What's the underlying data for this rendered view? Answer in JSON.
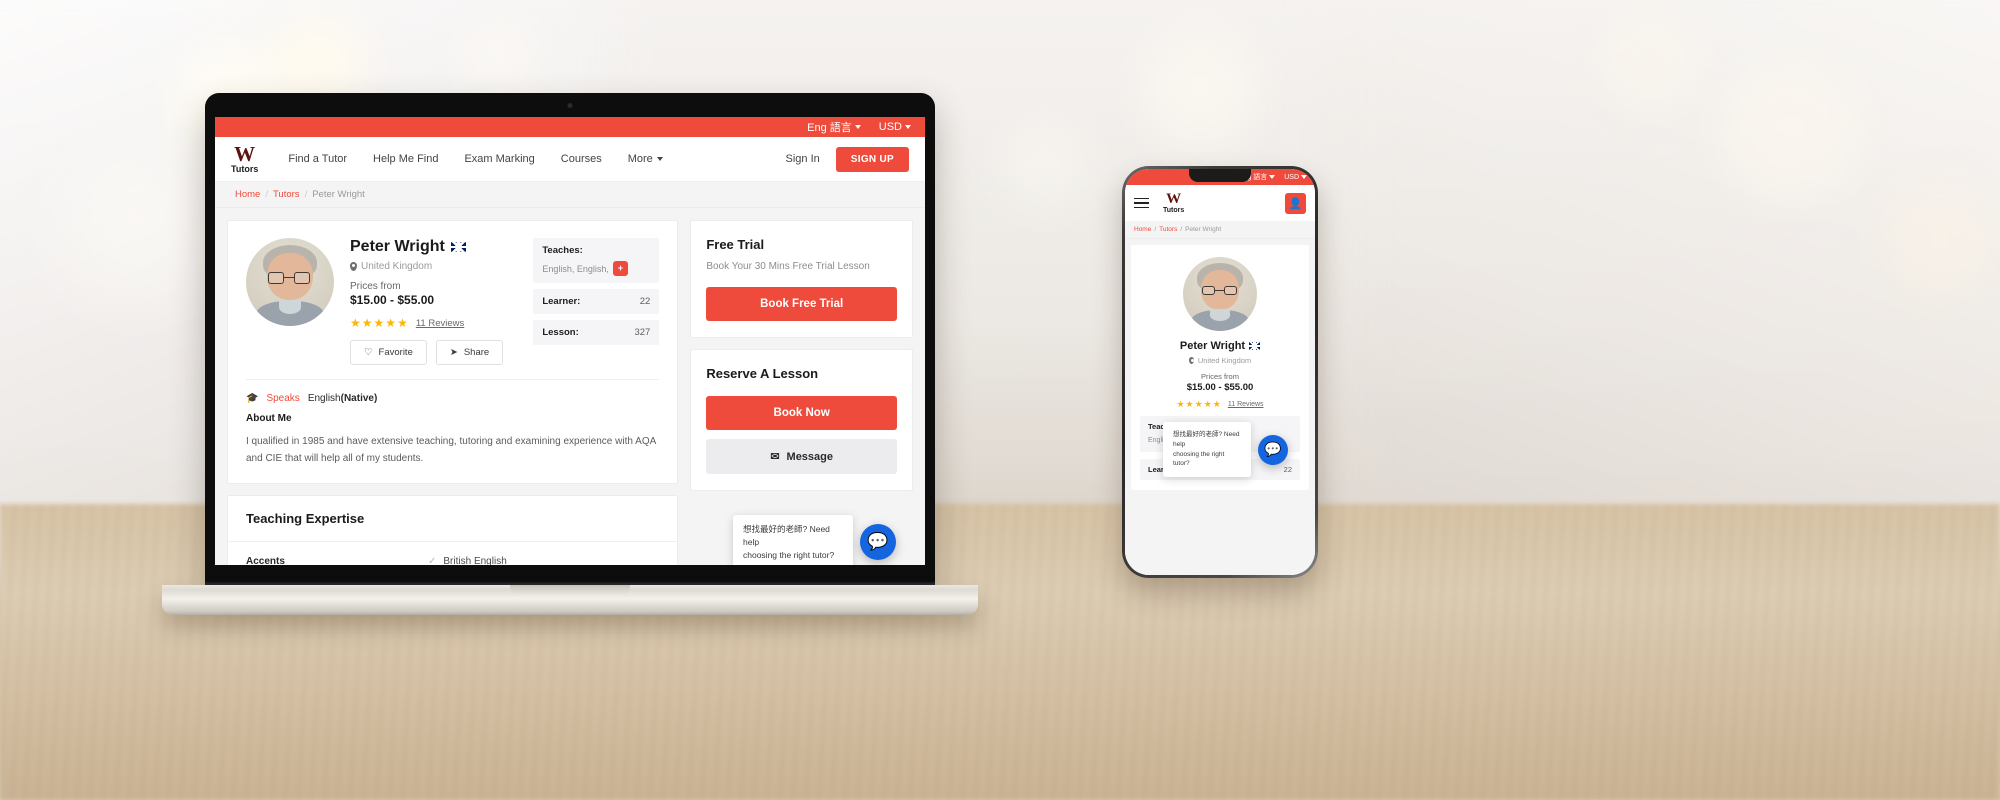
{
  "topbar": {
    "language": "Eng 語言",
    "currency": "USD"
  },
  "brand": {
    "w": "W",
    "tutors": "Tutors",
    "accent": "#ee4b3c",
    "logo_dark": "#5c1410"
  },
  "nav": {
    "links": [
      {
        "label": "Find a Tutor",
        "caret": false
      },
      {
        "label": "Help Me Find",
        "caret": false
      },
      {
        "label": "Exam Marking",
        "caret": false
      },
      {
        "label": "Courses",
        "caret": false
      },
      {
        "label": "More",
        "caret": true
      }
    ],
    "sign_in": "Sign In",
    "sign_up": "SIGN UP"
  },
  "breadcrumb": {
    "home": "Home",
    "tutors": "Tutors",
    "current": "Peter Wright",
    "sep": "/"
  },
  "profile": {
    "name": "Peter Wright",
    "flag": "uk-flag-icon",
    "location": "United Kingdom",
    "price_label": "Prices from",
    "price_value": "$15.00 - $55.00",
    "stars": 5,
    "star_glyph": "★",
    "reviews": "11 Reviews",
    "favorite": "Favorite",
    "share": "Share"
  },
  "stats": {
    "teaches_label": "Teaches:",
    "teaches_value": "English, English,",
    "teaches_plus": "+",
    "learner_label": "Learner:",
    "learner_value": "22",
    "lesson_label": "Lesson:",
    "lesson_value": "327"
  },
  "speaks": {
    "label": "Speaks",
    "language": "English",
    "level": "(Native)",
    "about_heading": "About Me",
    "about_text": "I qualified in 1985 and have extensive teaching, tutoring and examining experience with AQA and CIE that will help all of my students."
  },
  "expertise": {
    "heading": "Teaching Expertise",
    "rows": [
      {
        "key": "Accents",
        "value": "British English"
      }
    ]
  },
  "free_trial": {
    "title": "Free Trial",
    "subtitle": "Book Your 30 Mins Free Trial Lesson",
    "button": "Book Free Trial"
  },
  "reserve": {
    "title": "Reserve A Lesson",
    "book_now": "Book Now",
    "message": "Message"
  },
  "chat": {
    "line1": "想找最好的老師?  Need help",
    "line2": "choosing the right tutor?",
    "fab_color": "#1565e0"
  }
}
